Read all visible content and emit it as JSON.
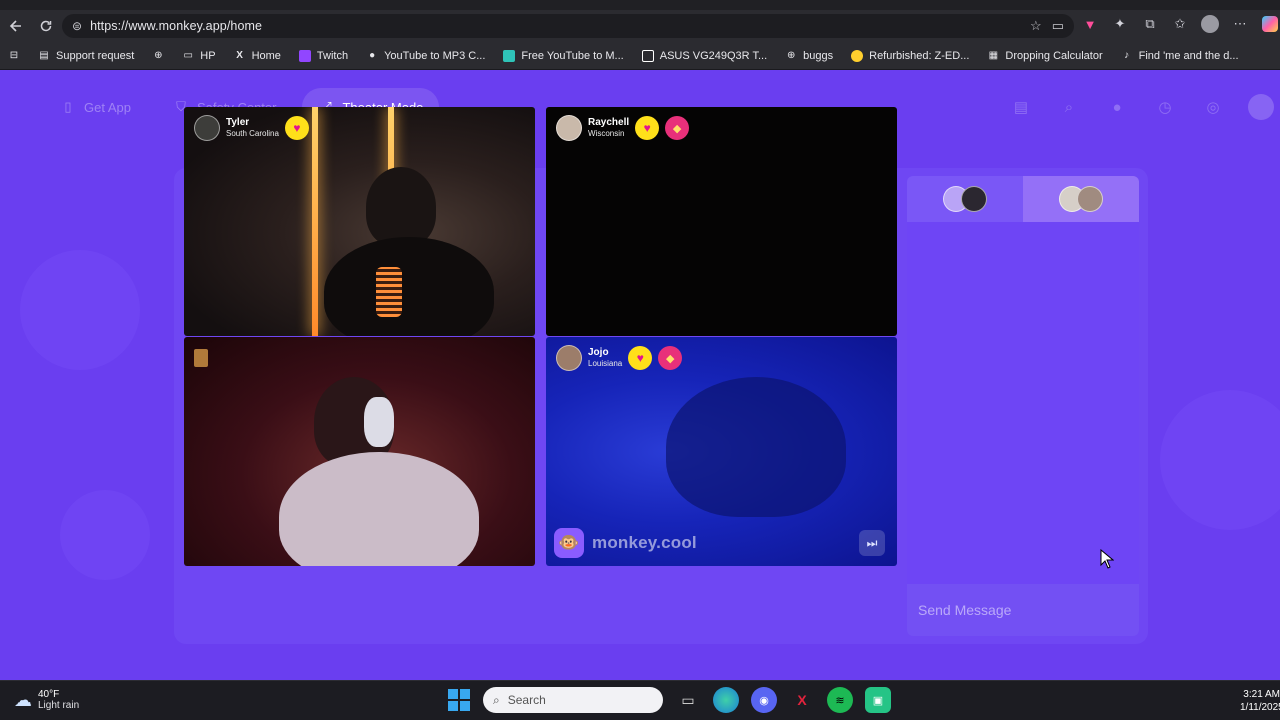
{
  "browser": {
    "url": "https://www.monkey.app/home",
    "bookmarks": [
      {
        "label": "Support request",
        "icon": "bookmark-icon"
      },
      {
        "label": "",
        "icon": "globe-icon"
      },
      {
        "label": "HP",
        "icon": "folder-icon"
      },
      {
        "label": "Home",
        "icon": "x-logo-icon"
      },
      {
        "label": "Twitch",
        "icon": "twitch-icon"
      },
      {
        "label": "YouTube to MP3 C...",
        "icon": "converter-icon"
      },
      {
        "label": "Free YouTube to M...",
        "icon": "yt-icon"
      },
      {
        "label": "ASUS VG249Q3R T...",
        "icon": "monitor-icon"
      },
      {
        "label": "buggs",
        "icon": "globe-icon"
      },
      {
        "label": "Refurbished: Z-ED...",
        "icon": "tag-icon"
      },
      {
        "label": "Dropping Calculator",
        "icon": "calculator-icon"
      },
      {
        "label": "Find 'me and the d...",
        "icon": "tiktok-icon"
      }
    ]
  },
  "nav": {
    "get_app": "Get App",
    "safety_center": "Safety Center",
    "theater_mode": "Theater Mode"
  },
  "tiles": [
    {
      "name": "Tyler",
      "location": "South Carolina"
    },
    {
      "name": "Raychell",
      "location": "Wisconsin"
    },
    {
      "name": "",
      "location": ""
    },
    {
      "name": "Jojo",
      "location": "Louisiana"
    }
  ],
  "brand": {
    "text": "monkey.cool"
  },
  "chat": {
    "placeholder": "Send Message"
  },
  "taskbar": {
    "weather_temp": "40°F",
    "weather_desc": "Light rain",
    "search_placeholder": "Search",
    "time": "3:21 AM",
    "date": "1/11/2025"
  },
  "colors": {
    "page_bg": "#6a3ef0",
    "heart_badge": "#ffe01a",
    "accent_pink": "#e3138e"
  }
}
